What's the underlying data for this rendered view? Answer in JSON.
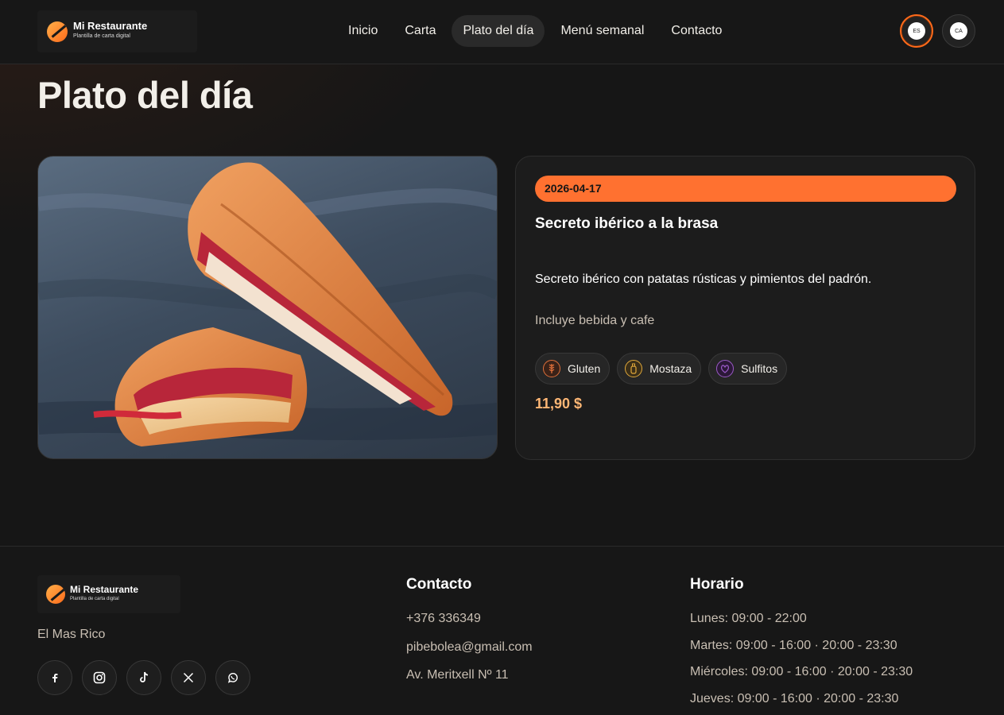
{
  "brand": {
    "name": "Mi Restaurante",
    "tagline": "Plantilla de carta digital"
  },
  "nav": {
    "items": [
      {
        "label": "Inicio"
      },
      {
        "label": "Carta"
      },
      {
        "label": "Plato del día",
        "active": true
      },
      {
        "label": "Menú semanal"
      },
      {
        "label": "Contacto"
      }
    ]
  },
  "languages": [
    {
      "code": "ES",
      "active": true
    },
    {
      "code": "CA",
      "active": false
    }
  ],
  "page": {
    "title": "Plato del día"
  },
  "dish": {
    "image_icon": "sandwich-photo",
    "date": "2026-04-17",
    "name": "Secreto ibérico a la brasa",
    "description": "Secreto ibérico con patatas rústicas y pimientos del padrón.",
    "note": "Incluye bebida y cafe",
    "allergens": [
      {
        "label": "Gluten",
        "icon": "wheat-icon",
        "color": "#e0703a"
      },
      {
        "label": "Mostaza",
        "icon": "mustard-icon",
        "color": "#e0a83a"
      },
      {
        "label": "Sulfitos",
        "icon": "wine-icon",
        "color": "#9b5ac8"
      }
    ],
    "price": "11,90 $"
  },
  "footer": {
    "tagline": "El Mas Rico",
    "socials": [
      "facebook-icon",
      "instagram-icon",
      "tiktok-icon",
      "x-icon",
      "whatsapp-icon"
    ],
    "contact": {
      "title": "Contacto",
      "phone": "+376 336349",
      "email": "pibebolea@gmail.com",
      "address": "Av. Meritxell Nº 11"
    },
    "hours": {
      "title": "Horario",
      "lines": [
        "Lunes: 09:00 - 22:00",
        "Martes: 09:00 - 16:00 · 20:00 - 23:30",
        "Miércoles: 09:00 - 16:00 · 20:00 - 23:30",
        "Jueves: 09:00 - 16:00 · 20:00 - 23:30"
      ]
    }
  },
  "colors": {
    "accent": "#ff7130",
    "price": "#ffb775",
    "background": "#161616"
  }
}
